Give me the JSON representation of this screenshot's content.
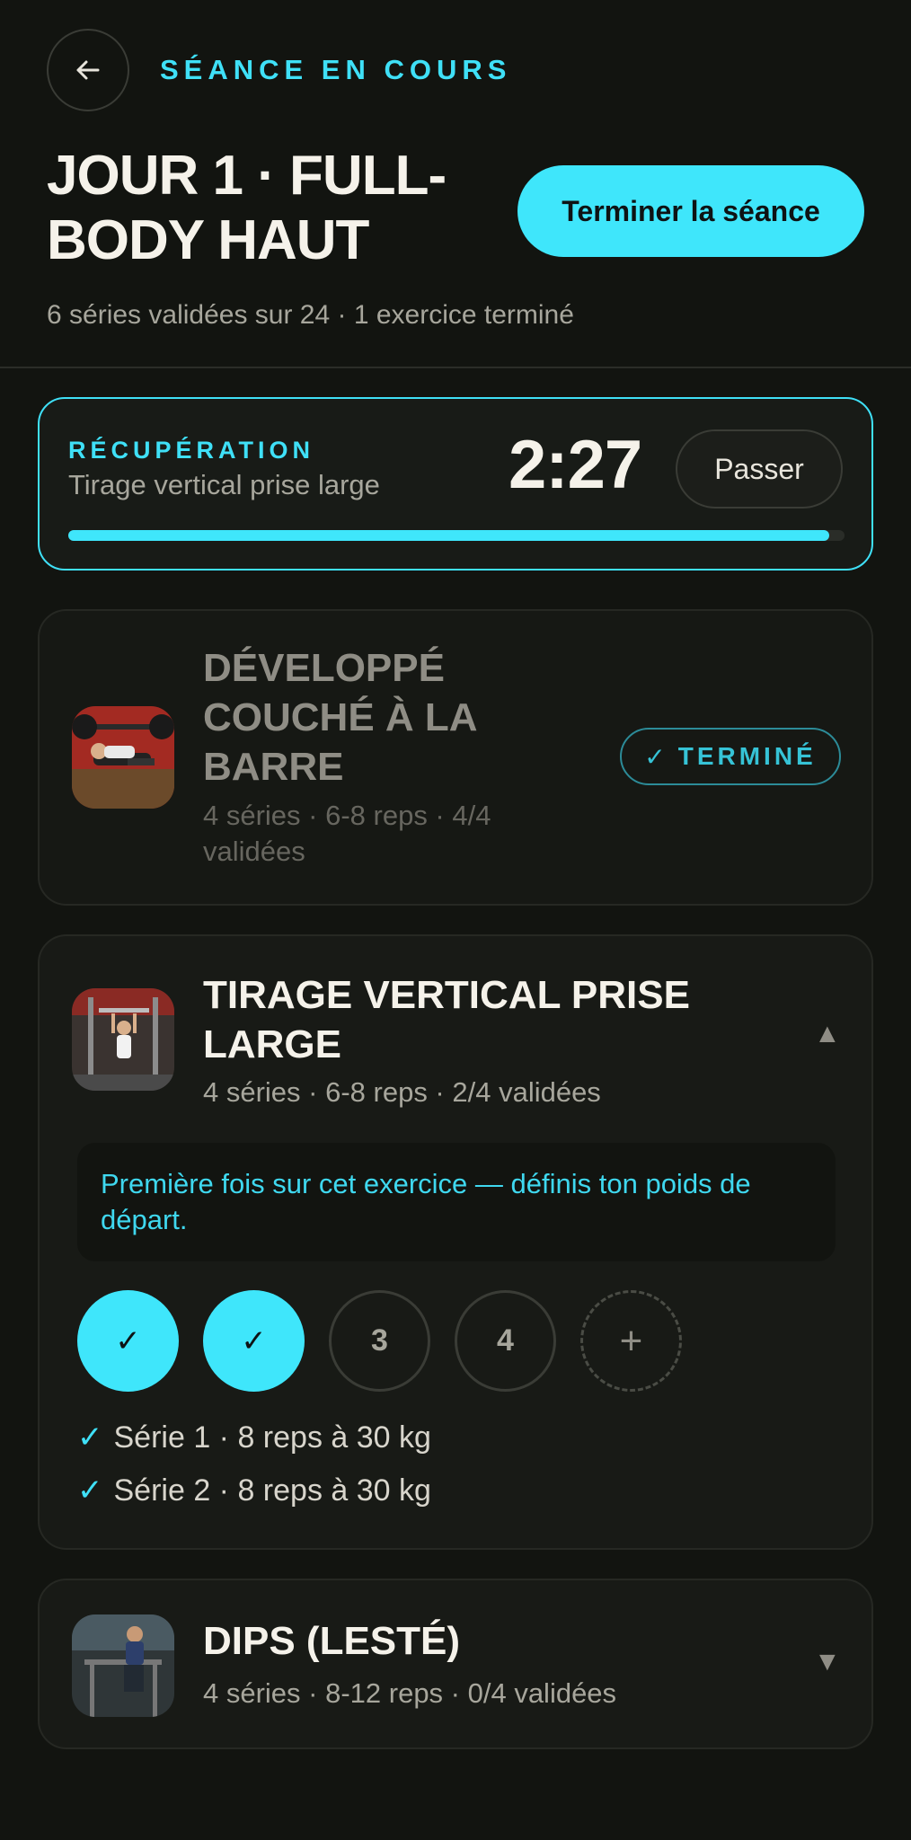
{
  "header": {
    "eyebrow": "SÉANCE EN COURS",
    "title": "JOUR 1 · FULL-BODY HAUT",
    "finish_label": "Terminer la séance",
    "subtitle": "6 séries validées sur 24 · 1 exercice terminé"
  },
  "rest": {
    "label": "RÉCUPÉRATION",
    "exercise": "Tirage vertical prise large",
    "time": "2:27",
    "skip_label": "Passer",
    "progress": 0.98
  },
  "exercises": [
    {
      "name": "DÉVELOPPÉ COUCHÉ À LA BARRE",
      "meta": "4 séries · 6-8 reps · 4/4 validées",
      "badge_check": "✓",
      "badge_label": "TERMINÉ",
      "state": "done"
    },
    {
      "name": "TIRAGE VERTICAL PRISE LARGE",
      "meta": "4 séries · 6-8 reps · 2/4 validées",
      "chevron": "▲",
      "notice": "Première fois sur cet exercice — définis ton poids de départ.",
      "sets": [
        "✓",
        "✓",
        "3",
        "4",
        "+"
      ],
      "log": [
        {
          "check": "✓",
          "text": "Série 1 · 8 reps à 30 kg"
        },
        {
          "check": "✓",
          "text": "Série 2 · 8 reps à 30 kg"
        }
      ],
      "state": "active"
    },
    {
      "name": "DIPS (LESTÉ)",
      "meta": "4 séries · 8-12 reps · 0/4 validées",
      "chevron": "▼",
      "state": "collapsed"
    }
  ],
  "colors": {
    "accent": "#3fe6fb",
    "background": "#121410",
    "card": "#181a16"
  },
  "icons": {
    "back": "arrow-left-icon"
  }
}
